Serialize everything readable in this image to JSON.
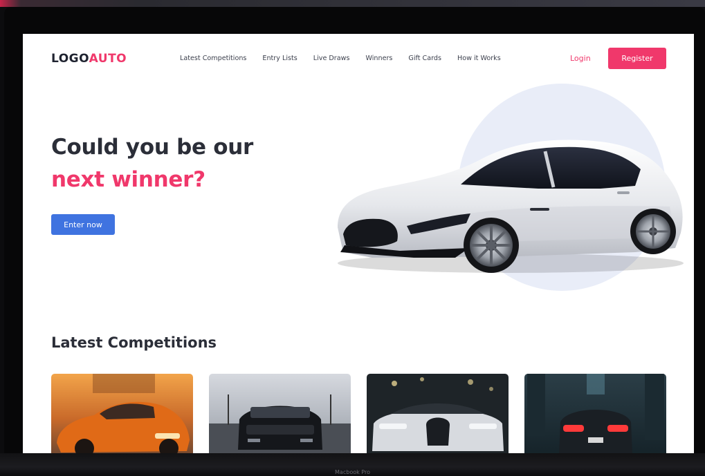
{
  "device": {
    "caption": "Macbook Pro"
  },
  "header": {
    "logo_text": "LOGO",
    "logo_accent": "AUTO",
    "nav": [
      {
        "label": "Latest Competitions"
      },
      {
        "label": "Entry Lists"
      },
      {
        "label": "Live Draws"
      },
      {
        "label": "Winners"
      },
      {
        "label": "Gift Cards"
      },
      {
        "label": "How it Works"
      }
    ],
    "login_label": "Login",
    "register_label": "Register"
  },
  "hero": {
    "line1": "Could you be our",
    "line2": "next winner?",
    "cta_label": "Enter now"
  },
  "competitions": {
    "title": "Latest Competitions",
    "cards": [
      {
        "image": "orange-sedan-photo"
      },
      {
        "image": "black-muscle-car-photo"
      },
      {
        "image": "white-hypercar-photo"
      },
      {
        "image": "sports-car-rear-night-photo"
      }
    ]
  },
  "colors": {
    "brand_pink": "#f0386b",
    "cta_blue": "#3f73e0",
    "heading_dark": "#2b2e38",
    "hero_circle": "#e9edf8"
  }
}
